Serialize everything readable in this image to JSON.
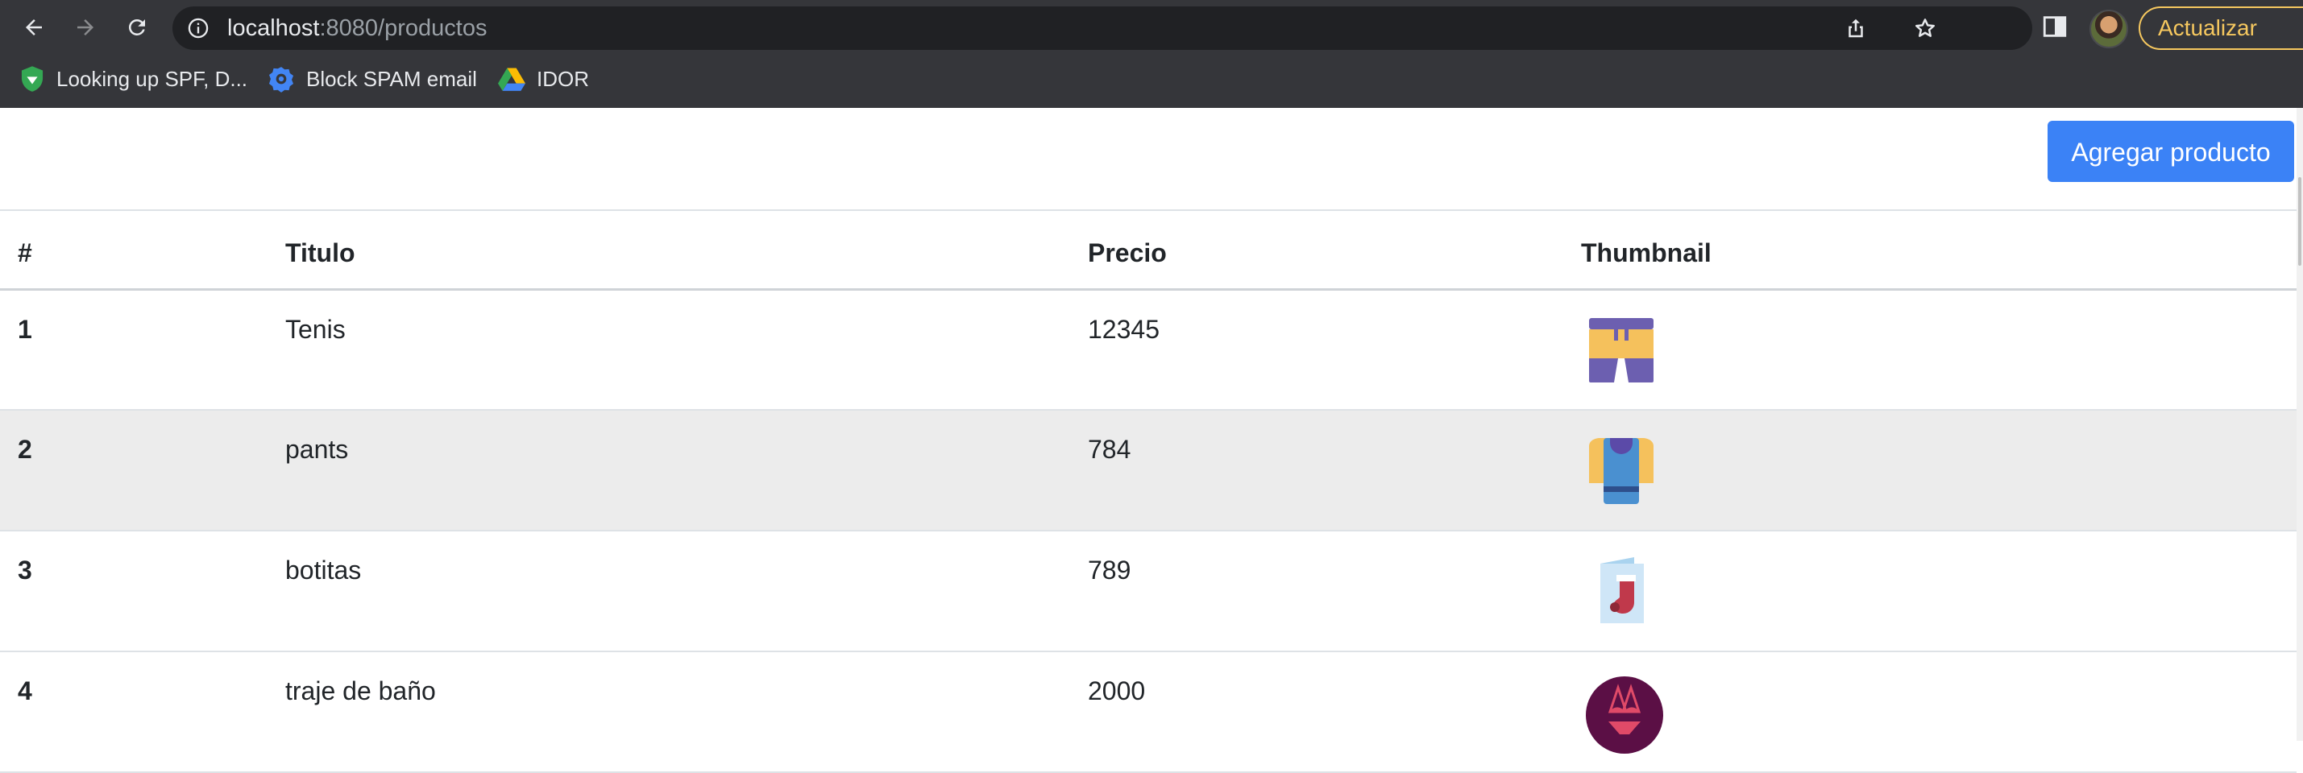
{
  "browser": {
    "url_host": "localhost",
    "url_rest": ":8080/productos",
    "update_label": "Actualizar",
    "accent_color": "#f6c85f",
    "icons": [
      "back-icon",
      "forward-icon",
      "reload-icon",
      "info-icon",
      "share-icon",
      "star-icon",
      "side-panel-icon",
      "avatar"
    ],
    "bookmarks": [
      {
        "label": "Looking up SPF, D...",
        "icon": "shield-icon"
      },
      {
        "label": "Block SPAM email",
        "icon": "gear-icon"
      },
      {
        "label": "IDOR",
        "icon": "drive-icon"
      }
    ]
  },
  "page": {
    "add_button_label": "Agregar producto",
    "button_color": "#3b82f6",
    "table": {
      "headers": [
        "#",
        "Titulo",
        "Precio",
        "Thumbnail"
      ],
      "rows": [
        {
          "id": "1",
          "title": "Tenis",
          "price": "12345",
          "thumbnail": "shorts-icon"
        },
        {
          "id": "2",
          "title": "pants",
          "price": "784",
          "thumbnail": "shirt-icon"
        },
        {
          "id": "3",
          "title": "botitas",
          "price": "789",
          "thumbnail": "sock-card-icon"
        },
        {
          "id": "4",
          "title": "traje de baño",
          "price": "2000",
          "thumbnail": "bikini-icon"
        }
      ]
    }
  }
}
